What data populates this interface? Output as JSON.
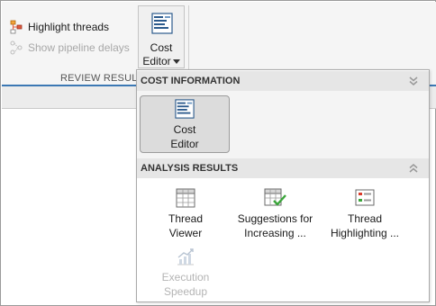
{
  "toolstrip": {
    "highlight_threads": "Highlight threads",
    "show_pipeline_delays": "Show pipeline delays",
    "cost_editor_line1": "Cost",
    "cost_editor_line2": "Editor",
    "section_label": "REVIEW RESULTS"
  },
  "dropdown": {
    "cost_info_header": "COST INFORMATION",
    "cost_editor": {
      "line1": "Cost",
      "line2": "Editor"
    },
    "analysis_header": "ANALYSIS RESULTS",
    "items": [
      {
        "line1": "Thread",
        "line2": "Viewer",
        "enabled": true
      },
      {
        "line1": "Suggestions for",
        "line2": "Increasing  ...",
        "enabled": true
      },
      {
        "line1": "Thread",
        "line2": "Highlighting ...",
        "enabled": true
      },
      {
        "line1": "Execution",
        "line2": "Speedup",
        "enabled": false
      }
    ]
  },
  "colors": {
    "accent": "#3c78b4",
    "header_bg": "#e6e6e6",
    "selected_tile": "#dcdcdc"
  }
}
